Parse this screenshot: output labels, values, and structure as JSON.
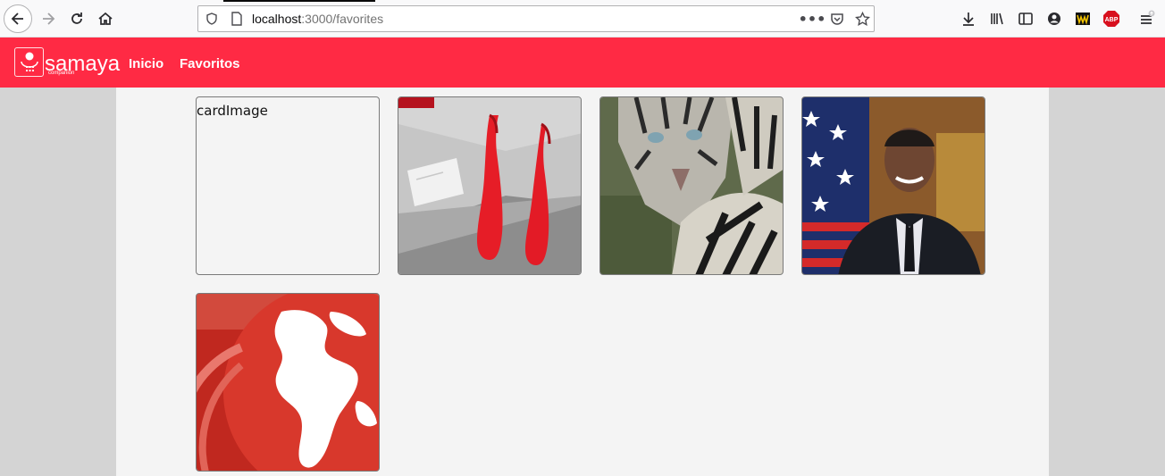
{
  "browser": {
    "url_host": "localhost",
    "url_rest": ":3000/favorites"
  },
  "navbar": {
    "logo_text": "samaya",
    "logo_sub": "companion",
    "links": [
      {
        "label": "Inicio"
      },
      {
        "label": "Favoritos"
      }
    ],
    "background": "#ff2a44"
  },
  "cards": [
    {
      "alt": "cardImage",
      "image": "broken"
    },
    {
      "alt": "",
      "image": "red-shoes"
    },
    {
      "alt": "",
      "image": "white-tiger"
    },
    {
      "alt": "",
      "image": "man-with-flag"
    },
    {
      "alt": "",
      "image": "red-globe"
    }
  ]
}
